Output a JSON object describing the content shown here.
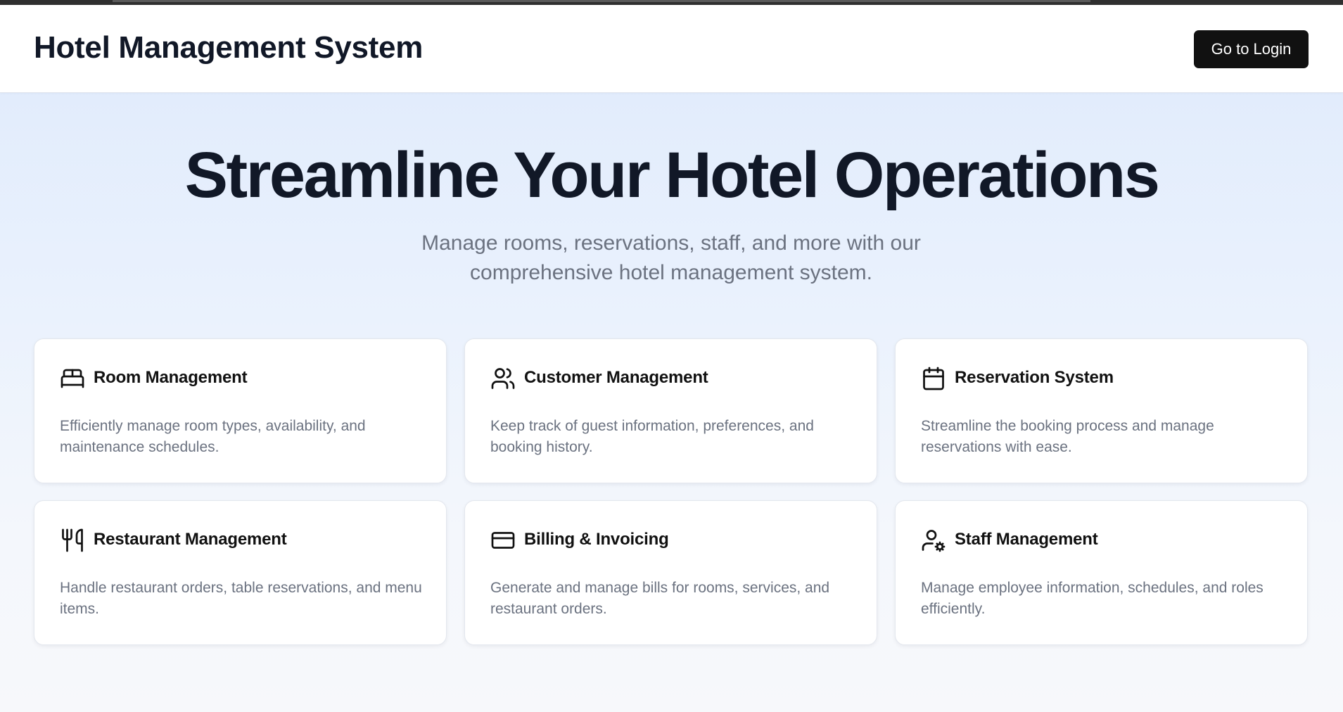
{
  "header": {
    "title": "Hotel Management System",
    "login_label": "Go to Login"
  },
  "hero": {
    "title": "Streamline Your Hotel Operations",
    "subtitle": "Manage rooms, reservations, staff, and more with our comprehensive hotel management system."
  },
  "features": [
    {
      "icon": "bed-icon",
      "title": "Room Management",
      "description": "Efficiently manage room types, availability, and maintenance schedules."
    },
    {
      "icon": "users-icon",
      "title": "Customer Management",
      "description": "Keep track of guest information, preferences, and booking history."
    },
    {
      "icon": "calendar-icon",
      "title": "Reservation System",
      "description": "Streamline the booking process and manage reservations with ease."
    },
    {
      "icon": "utensils-icon",
      "title": "Restaurant Management",
      "description": "Handle restaurant orders, table reservations, and menu items."
    },
    {
      "icon": "credit-card-icon",
      "title": "Billing & Invoicing",
      "description": "Generate and manage bills for rooms, services, and restaurant orders."
    },
    {
      "icon": "user-cog-icon",
      "title": "Staff Management",
      "description": "Manage employee information, schedules, and roles efficiently."
    }
  ],
  "colors": {
    "text_primary": "#111827",
    "text_muted": "#6b7280",
    "button_bg": "#111111",
    "hero_gradient_top": "#dfeafc"
  }
}
